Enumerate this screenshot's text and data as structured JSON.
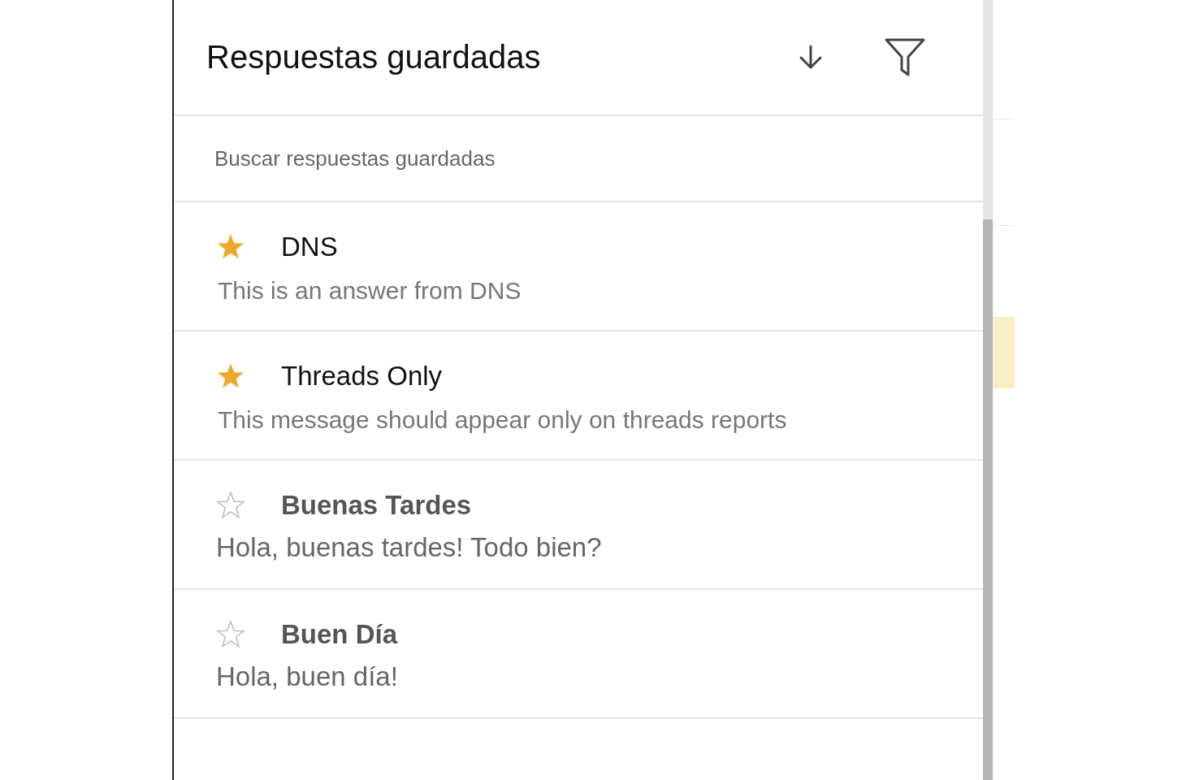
{
  "panel": {
    "title": "Respuestas guardadas"
  },
  "search": {
    "placeholder": "Buscar respuestas guardadas"
  },
  "answers": [
    {
      "title": "DNS",
      "text": "This is an answer from DNS",
      "starred": true
    },
    {
      "title": "Threads Only",
      "text": "This message should appear only on threads reports",
      "starred": true
    },
    {
      "title": "Buenas Tardes",
      "text": "Hola, buenas tardes! Todo bien?",
      "starred": false
    },
    {
      "title": "Buen Día",
      "text": "Hola, buen día!",
      "starred": false
    }
  ]
}
